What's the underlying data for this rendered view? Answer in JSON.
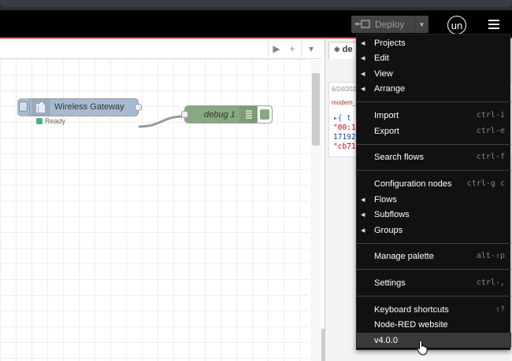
{
  "header": {
    "deploy_label": "Deploy",
    "user_initials": "un"
  },
  "workspace": {
    "tab_actions": [
      "▶",
      "+",
      "▾"
    ],
    "nodes": {
      "gateway": {
        "label": "Wireless Gateway",
        "status": "Ready",
        "status_color": "#5a8"
      },
      "debug": {
        "label": "debug 1"
      }
    }
  },
  "sidebar": {
    "tab_label": "de",
    "debug_time": "6/24/202",
    "debug_source": "modem_",
    "lines": [
      "▸{ t",
      "\"00:1",
      "17192",
      "\"cb71"
    ]
  },
  "menu": {
    "items": [
      {
        "label": "Projects",
        "shortcut": "",
        "submenu": true
      },
      {
        "label": "Edit",
        "shortcut": "",
        "submenu": true
      },
      {
        "label": "View",
        "shortcut": "",
        "submenu": true
      },
      {
        "label": "Arrange",
        "shortcut": "",
        "submenu": true
      },
      {
        "label": "Import",
        "shortcut": "ctrl-i",
        "submenu": false
      },
      {
        "label": "Export",
        "shortcut": "ctrl-e",
        "submenu": false
      },
      {
        "label": "Search flows",
        "shortcut": "ctrl-f",
        "submenu": false
      },
      {
        "label": "Configuration nodes",
        "shortcut": "ctrl-g c",
        "submenu": false
      },
      {
        "label": "Flows",
        "shortcut": "",
        "submenu": true
      },
      {
        "label": "Subflows",
        "shortcut": "",
        "submenu": true
      },
      {
        "label": "Groups",
        "shortcut": "",
        "submenu": true
      },
      {
        "label": "Manage palette",
        "shortcut": "alt-⇧p",
        "submenu": false
      },
      {
        "label": "Settings",
        "shortcut": "ctrl-,",
        "submenu": false
      },
      {
        "label": "Keyboard shortcuts",
        "shortcut": "⇧?",
        "submenu": false
      },
      {
        "label": "Node-RED website",
        "shortcut": "",
        "submenu": false
      },
      {
        "label": "v4.0.0",
        "shortcut": "",
        "submenu": false
      }
    ]
  },
  "colors": {
    "header_bg": "#000000",
    "gateway_node": "#a6bbcf",
    "debug_node": "#87a980",
    "menu_bg": "#111111"
  }
}
